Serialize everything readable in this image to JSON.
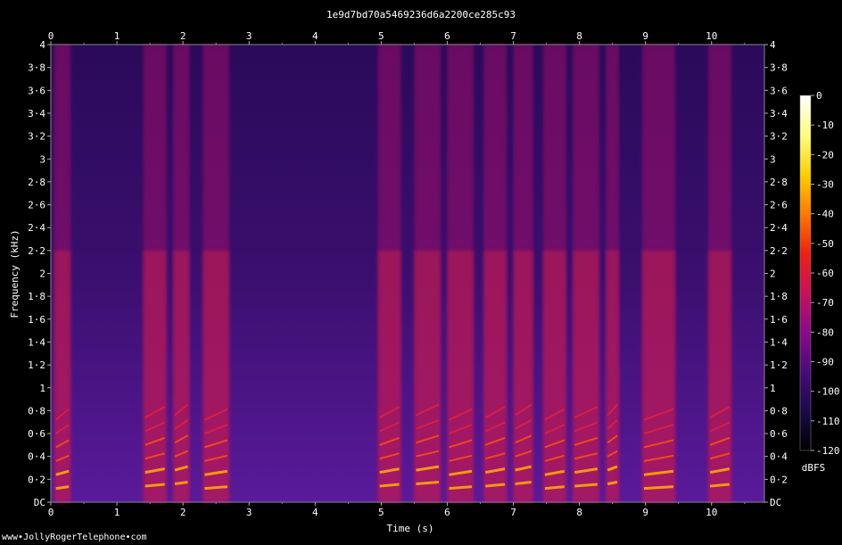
{
  "chart_data": {
    "type": "heatmap",
    "title": "1e9d7bd70a5469236d6a2200ce285c93",
    "xlabel": "Time (s)",
    "ylabel": "Frequency (kHz)",
    "xlim": [
      0,
      10.8
    ],
    "ylim": [
      0,
      4
    ],
    "x_ticks": [
      "0",
      "1",
      "2",
      "3",
      "4",
      "5",
      "6",
      "7",
      "8",
      "9",
      "10"
    ],
    "y_ticks": [
      "DC",
      "0·2",
      "0·4",
      "0·6",
      "0·8",
      "1",
      "1·2",
      "1·4",
      "1·6",
      "1·8",
      "2",
      "2·2",
      "2·4",
      "2·6",
      "2·8",
      "3",
      "3·2",
      "3·4",
      "3·6",
      "3·8",
      "4"
    ],
    "colorbar": {
      "label": "dBFS",
      "range": [
        -120,
        0
      ],
      "ticks": [
        "0",
        "-10",
        "-20",
        "-30",
        "-40",
        "-50",
        "-60",
        "-70",
        "-80",
        "-90",
        "-100",
        "-110",
        "-120"
      ],
      "colors": [
        "#000000",
        "#1a0a4a",
        "#4a0a7a",
        "#8a0a8a",
        "#c8105a",
        "#f02010",
        "#ff7a00",
        "#ffd000",
        "#ffff80",
        "#ffffff"
      ]
    },
    "speech_segments_s": [
      [
        0.05,
        0.3
      ],
      [
        1.4,
        1.75
      ],
      [
        1.85,
        2.1
      ],
      [
        2.3,
        2.7
      ],
      [
        4.95,
        5.3
      ],
      [
        5.5,
        5.9
      ],
      [
        6.0,
        6.4
      ],
      [
        6.55,
        6.9
      ],
      [
        7.0,
        7.3
      ],
      [
        7.45,
        7.8
      ],
      [
        7.9,
        8.3
      ],
      [
        8.4,
        8.6
      ],
      [
        8.95,
        9.45
      ],
      [
        9.95,
        10.3
      ]
    ]
  },
  "watermark": "www•JollyRogerTelephone•com"
}
